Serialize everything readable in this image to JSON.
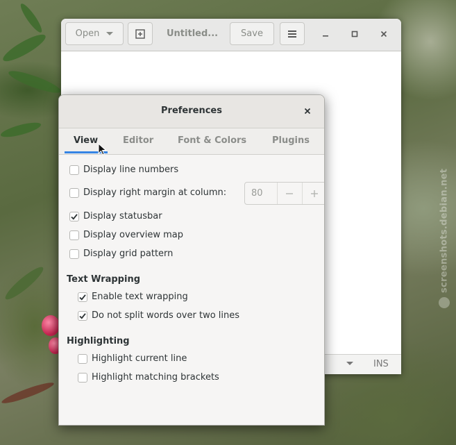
{
  "editor": {
    "open_label": "Open",
    "doc_title": "Untitled...",
    "save_label": "Save",
    "status_mode": "INS"
  },
  "watermark": "screenshots.debian.net",
  "preferences": {
    "title": "Preferences",
    "tabs": [
      "View",
      "Editor",
      "Font & Colors",
      "Plugins"
    ],
    "active_tab": "View",
    "view": {
      "display_line_numbers": {
        "label": "Display line numbers",
        "checked": false
      },
      "display_right_margin": {
        "label": "Display right margin at column:",
        "checked": false,
        "value": "80"
      },
      "display_statusbar": {
        "label": "Display statusbar",
        "checked": true
      },
      "display_overview_map": {
        "label": "Display overview map",
        "checked": false
      },
      "display_grid_pattern": {
        "label": "Display grid pattern",
        "checked": false
      }
    },
    "text_wrapping": {
      "heading": "Text Wrapping",
      "enable_text_wrapping": {
        "label": "Enable text wrapping",
        "checked": true
      },
      "no_split_words": {
        "label": "Do not split words over two lines",
        "checked": true
      }
    },
    "highlighting": {
      "heading": "Highlighting",
      "highlight_current_line": {
        "label": "Highlight current line",
        "checked": false
      },
      "highlight_matching_brackets": {
        "label": "Highlight matching brackets",
        "checked": false
      }
    }
  },
  "colors": {
    "accent": "#3584e4",
    "text": "#2e3436",
    "dim": "#8b8d8a"
  }
}
